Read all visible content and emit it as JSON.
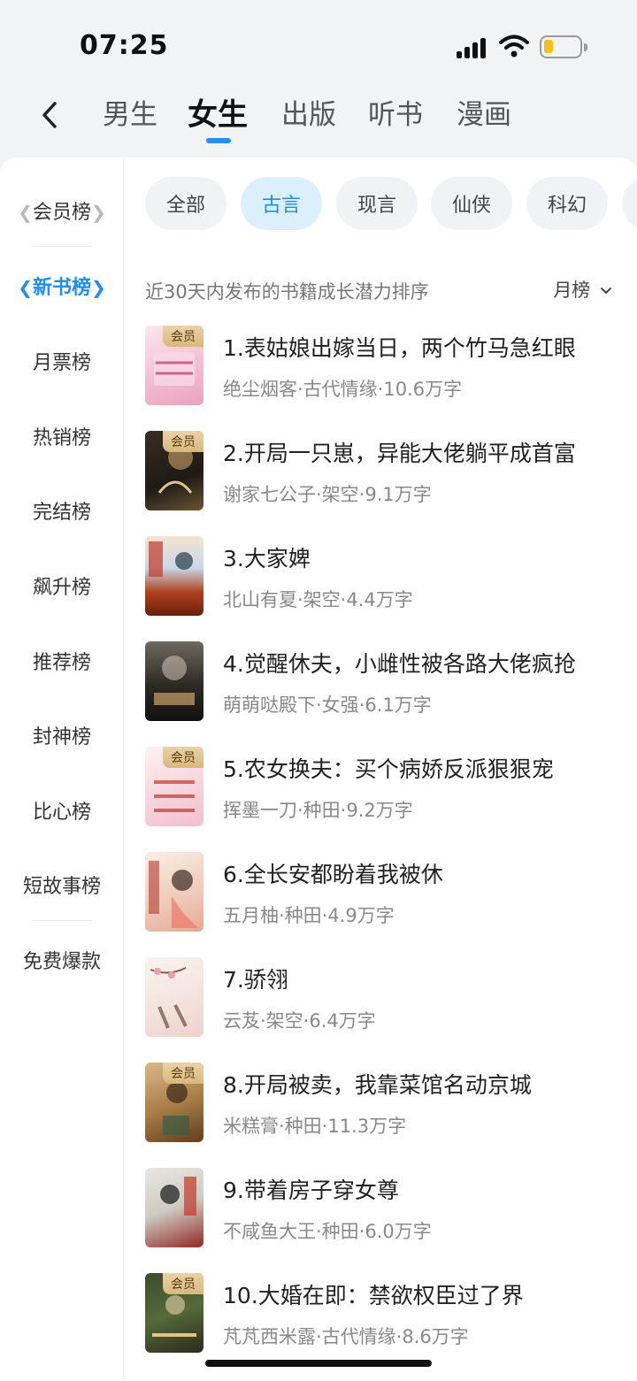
{
  "status": {
    "time": "07:25"
  },
  "nav": {
    "tabs": [
      {
        "label": "男生"
      },
      {
        "label": "女生"
      },
      {
        "label": "出版"
      },
      {
        "label": "听书"
      },
      {
        "label": "漫画"
      }
    ],
    "active_tab": "女生"
  },
  "sidebar": {
    "items": [
      {
        "label": "会员榜"
      },
      {
        "label": "新书榜"
      },
      {
        "label": "月票榜"
      },
      {
        "label": "热销榜"
      },
      {
        "label": "完结榜"
      },
      {
        "label": "飙升榜"
      },
      {
        "label": "推荐榜"
      },
      {
        "label": "封神榜"
      },
      {
        "label": "比心榜"
      },
      {
        "label": "短故事榜"
      },
      {
        "label": "免费爆款"
      }
    ],
    "active_item": "新书榜"
  },
  "filters": {
    "chips": [
      {
        "label": "全部"
      },
      {
        "label": "古言"
      },
      {
        "label": "现言"
      },
      {
        "label": "仙侠"
      },
      {
        "label": "科幻"
      }
    ],
    "active_chip": "古言"
  },
  "list_header": {
    "description": "近30天内发布的书籍成长潜力排序",
    "sort_label": "月榜"
  },
  "vip_label": "会员",
  "books": [
    {
      "title": "1.表姑娘出嫁当日，两个竹马急红眼",
      "meta": "绝尘烟客·古代情缘·10.6万字",
      "vip": true
    },
    {
      "title": "2.开局一只崽，异能大佬躺平成首富",
      "meta": "谢家七公子·架空·9.1万字",
      "vip": true
    },
    {
      "title": "3.大家婢",
      "meta": "北山有夏·架空·4.4万字",
      "vip": false
    },
    {
      "title": "4.觉醒休夫，小雌性被各路大佬疯抢",
      "meta": "萌萌哒殿下·女强·6.1万字",
      "vip": false
    },
    {
      "title": "5.农女换夫：买个病娇反派狠狠宠",
      "meta": "挥墨一刀·种田·9.2万字",
      "vip": true
    },
    {
      "title": "6.全长安都盼着我被休",
      "meta": "五月柚·种田·4.9万字",
      "vip": false
    },
    {
      "title": "7.骄翎",
      "meta": "云芨·架空·6.4万字",
      "vip": false
    },
    {
      "title": "8.开局被卖，我靠菜馆名动京城",
      "meta": "米糕膏·种田·11.3万字",
      "vip": true
    },
    {
      "title": "9.带着房子穿女尊",
      "meta": "不咸鱼大王·种田·6.0万字",
      "vip": false
    },
    {
      "title": "10.大婚在即：禁欲权臣过了界",
      "meta": "芃芃西米露·古代情缘·8.6万字",
      "vip": true
    }
  ],
  "colors": {
    "accent": "#1e8ef5",
    "vip_gold": "#d9b77c"
  }
}
